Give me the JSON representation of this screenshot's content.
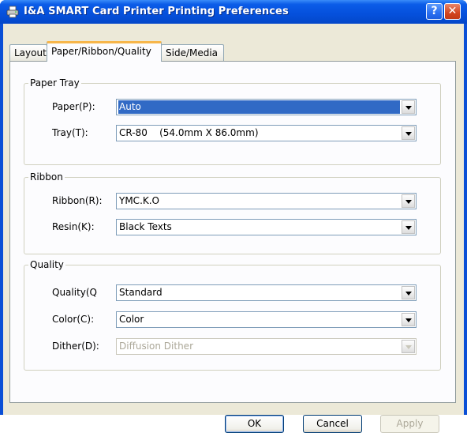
{
  "window": {
    "title": "I&A SMART Card Printer Printing Preferences",
    "help_label": "?",
    "close_label": "✕"
  },
  "tabs": [
    {
      "label": "Layout"
    },
    {
      "label": "Paper/Ribbon/Quality"
    },
    {
      "label": "Side/Media"
    }
  ],
  "paper_tray": {
    "title": "Paper Tray",
    "paper_label": "Paper(P):",
    "paper_value": "Auto",
    "tray_label": "Tray(T):",
    "tray_value": "CR-80    (54.0mm X 86.0mm)"
  },
  "ribbon": {
    "title": "Ribbon",
    "ribbon_label": "Ribbon(R):",
    "ribbon_value": "YMC.K.O",
    "resin_label": "Resin(K):",
    "resin_value": "Black Texts"
  },
  "quality": {
    "title": "Quality",
    "quality_label": "Quality(Q",
    "quality_value": "Standard",
    "color_label": "Color(C):",
    "color_value": "Color",
    "dither_label": "Dither(D):",
    "dither_value": "Diffusion Dither"
  },
  "buttons": {
    "ok": "OK",
    "cancel": "Cancel",
    "apply": "Apply"
  },
  "colors": {
    "titlebar": "#0550dc",
    "selection": "#316ac5",
    "active_tab_accent": "#f7b64a",
    "dialog_bg": "#ece9d8"
  }
}
